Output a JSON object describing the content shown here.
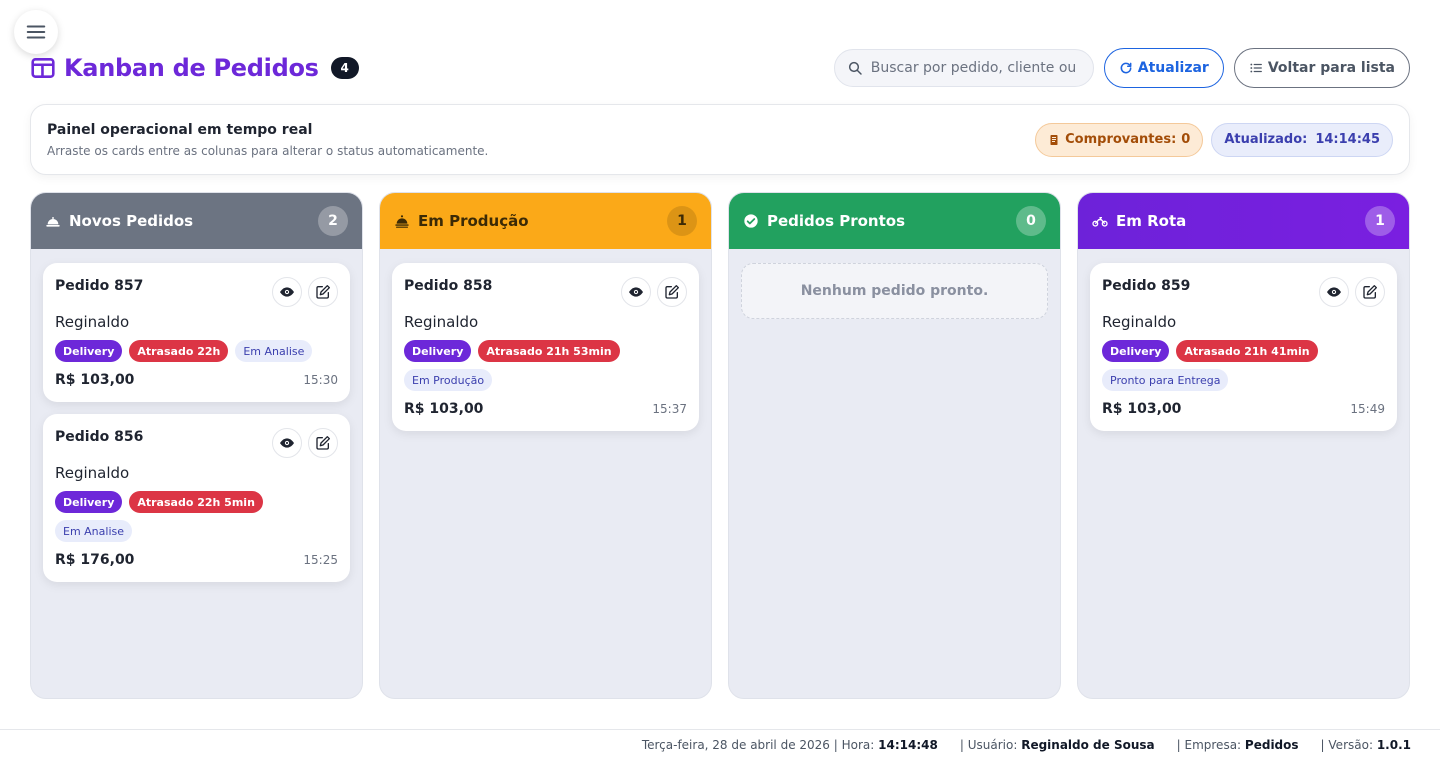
{
  "header": {
    "title": "Kanban de Pedidos",
    "count": "4",
    "search_placeholder": "Buscar por pedido, cliente ou",
    "refresh_label": "Atualizar",
    "back_label": "Voltar para lista"
  },
  "panel": {
    "title": "Painel operacional em tempo real",
    "subtitle": "Arraste os cards entre as colunas para alterar o status automaticamente.",
    "receipts_label": "Comprovantes:",
    "receipts_count": "0",
    "updated_label": "Atualizado:",
    "updated_time": "14:14:45"
  },
  "columns": [
    {
      "title": "Novos Pedidos",
      "count": "2",
      "color": "#6c7482",
      "cards": [
        {
          "title": "Pedido 857",
          "customer": "Reginaldo",
          "tags": [
            "Delivery",
            "Atrasado 22h",
            "Em Analise"
          ],
          "price": "R$ 103,00",
          "time": "15:30"
        },
        {
          "title": "Pedido 856",
          "customer": "Reginaldo",
          "tags": [
            "Delivery",
            "Atrasado 22h 5min",
            "Em Analise"
          ],
          "price": "R$ 176,00",
          "time": "15:25"
        }
      ]
    },
    {
      "title": "Em Produção",
      "count": "1",
      "color": "#fba918",
      "cards": [
        {
          "title": "Pedido 858",
          "customer": "Reginaldo",
          "tags": [
            "Delivery",
            "Atrasado 21h 53min",
            "Em Produção"
          ],
          "price": "R$ 103,00",
          "time": "15:37"
        }
      ]
    },
    {
      "title": "Pedidos Prontos",
      "count": "0",
      "color": "#22a15f",
      "empty_text": "Nenhum pedido pronto."
    },
    {
      "title": "Em Rota",
      "count": "1",
      "color": "#6d22d9",
      "cards": [
        {
          "title": "Pedido 859",
          "customer": "Reginaldo",
          "tags": [
            "Delivery",
            "Atrasado 21h 41min",
            "Pronto para Entrega"
          ],
          "price": "R$ 103,00",
          "time": "15:49"
        }
      ]
    }
  ],
  "footer": {
    "date": "Terça-feira, 28 de abril de 2026",
    "time_label": "| Hora:",
    "time": "14:14:48",
    "user_label": "| Usuário:",
    "user": "Reginaldo de Sousa",
    "company_label": "| Empresa:",
    "company": "Pedidos",
    "version_label": "| Versão:",
    "version": "1.0.1"
  }
}
